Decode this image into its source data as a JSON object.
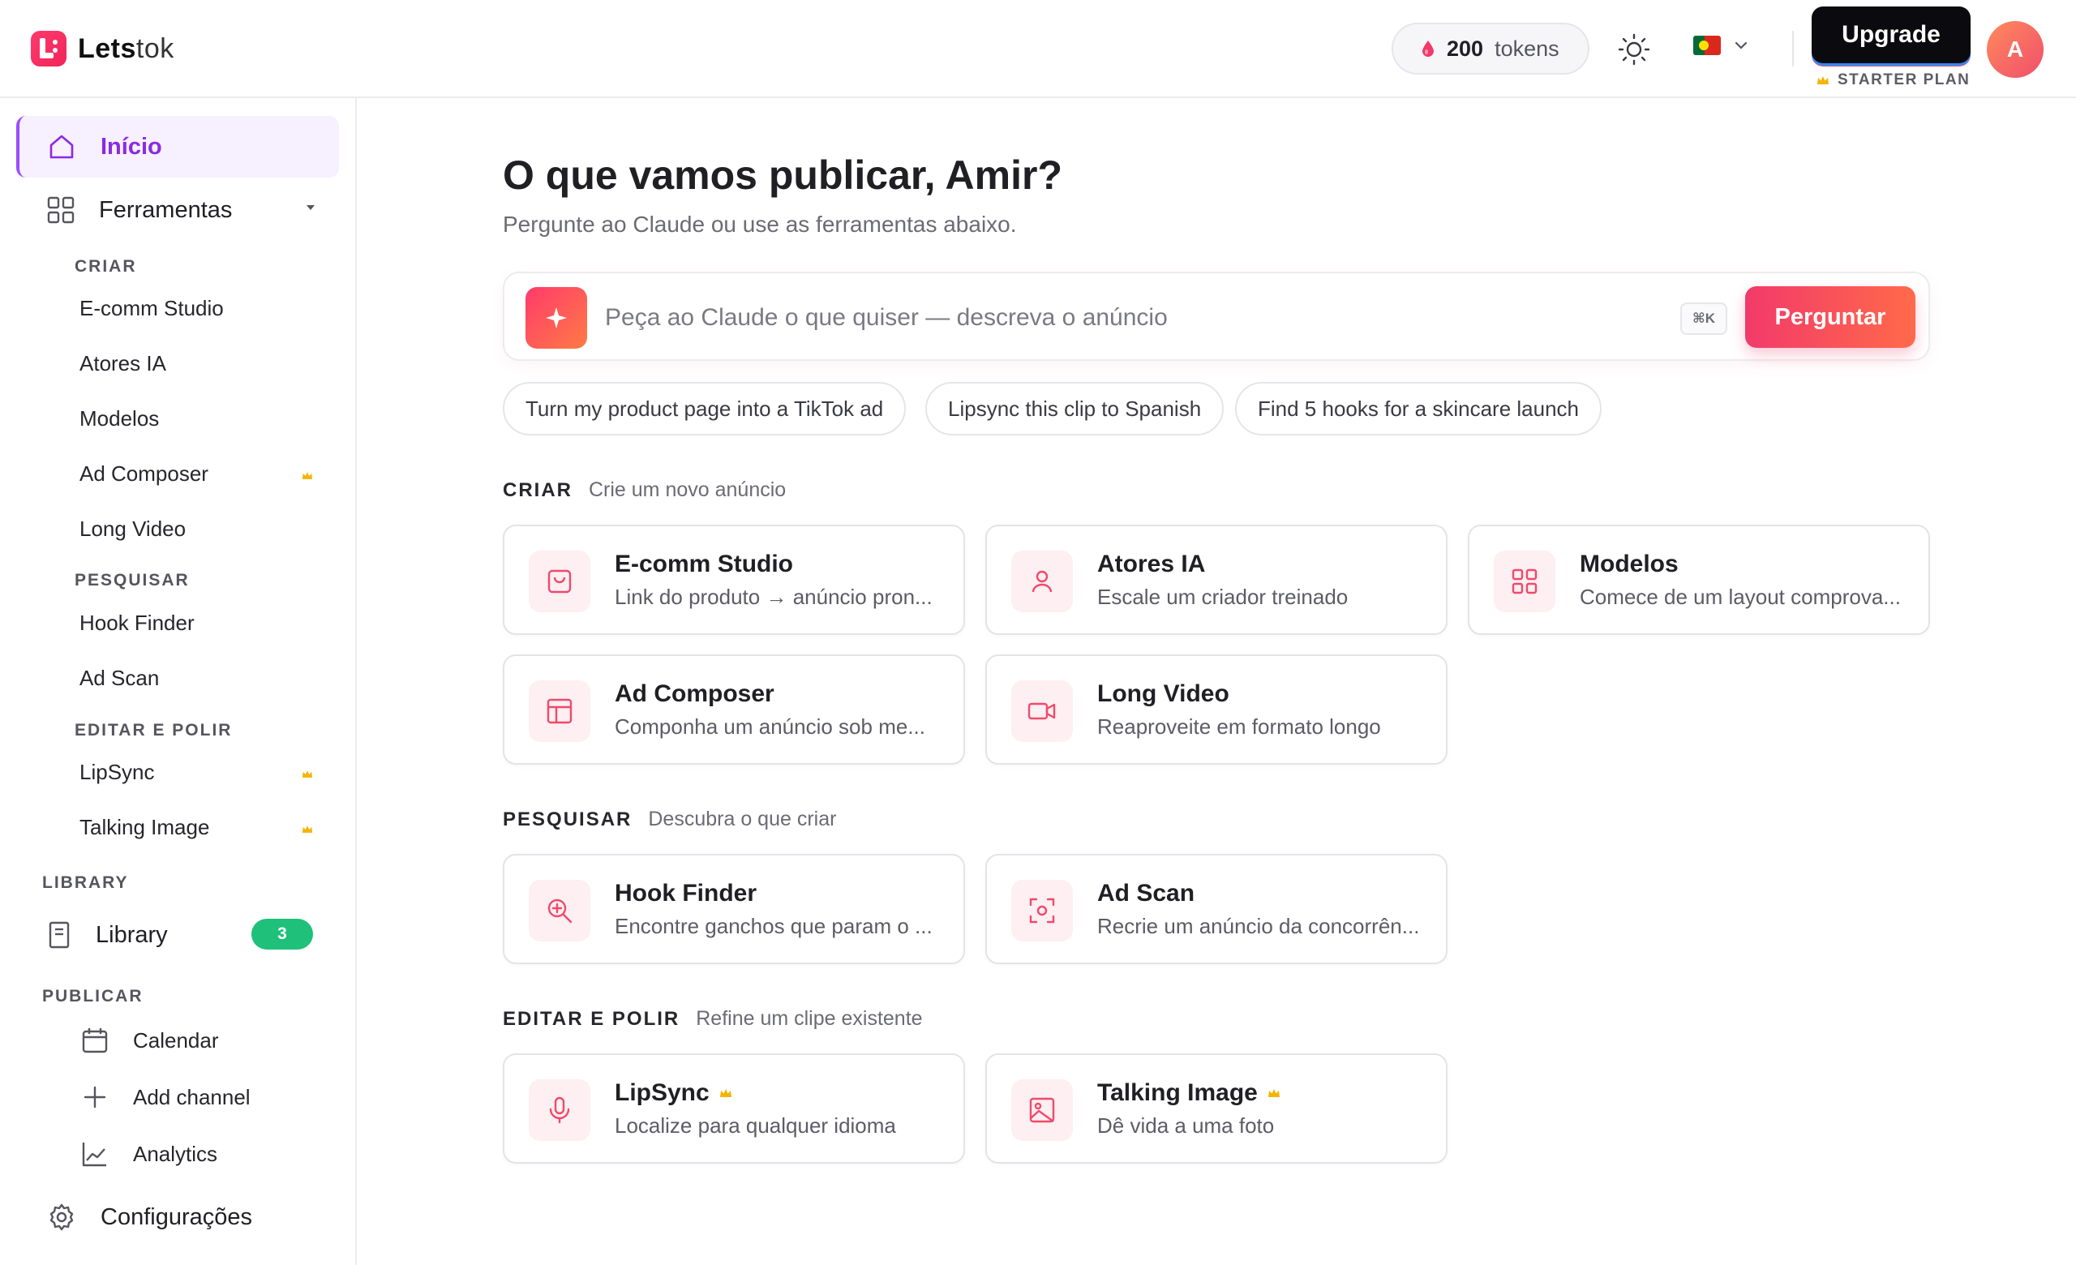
{
  "brand": {
    "name_bold": "Lets",
    "name_light": "tok"
  },
  "header": {
    "tokens_count": "200",
    "tokens_label": "tokens",
    "upgrade_label": "Upgrade",
    "plan_label": "STARTER PLAN",
    "avatar_initial": "A",
    "language": "Portuguese"
  },
  "sidebar": {
    "home": "Início",
    "tools": "Ferramentas",
    "sections": {
      "criar": "CRIAR",
      "pesquisar": "PESQUISAR",
      "editar": "EDITAR E POLIR",
      "library": "LIBRARY",
      "publicar": "PUBLICAR"
    },
    "criar_items": [
      "E-comm Studio",
      "Atores IA",
      "Modelos",
      "Ad Composer",
      "Long Video"
    ],
    "pesquisar_items": [
      "Hook Finder",
      "Ad Scan"
    ],
    "editar_items": [
      "LipSync",
      "Talking Image"
    ],
    "library_label": "Library",
    "library_count": "3",
    "publicar_items": [
      "Calendar",
      "Add channel",
      "Analytics"
    ],
    "settings": "Configurações"
  },
  "main": {
    "title": "O que vamos publicar, Amir?",
    "subtitle": "Pergunte ao Claude ou use as ferramentas abaixo.",
    "ask": {
      "placeholder": "Peça ao Claude o que quiser — descreva o anúncio",
      "shortcut": "⌘K",
      "button": "Perguntar"
    },
    "suggestions": [
      "Turn my product page into a TikTok ad",
      "Lipsync this clip to Spanish",
      "Find 5 hooks for a skincare launch"
    ],
    "sections": [
      {
        "title": "CRIAR",
        "desc": "Crie um novo anúncio",
        "cards": [
          {
            "title": "E-comm Studio",
            "desc": "Link do produto → anúncio pron...",
            "icon": "bag-icon"
          },
          {
            "title": "Atores IA",
            "desc": "Escale um criador treinado",
            "icon": "user-icon"
          },
          {
            "title": "Modelos",
            "desc": "Comece de um layout comprova...",
            "icon": "grid-icon"
          },
          {
            "title": "Ad Composer",
            "desc": "Componha um anúncio sob me...",
            "icon": "layout-icon"
          },
          {
            "title": "Long Video",
            "desc": "Reaproveite em formato longo",
            "icon": "video-icon"
          }
        ]
      },
      {
        "title": "PESQUISAR",
        "desc": "Descubra o que criar",
        "cards": [
          {
            "title": "Hook Finder",
            "desc": "Encontre ganchos que param o ...",
            "icon": "zoom-icon"
          },
          {
            "title": "Ad Scan",
            "desc": "Recrie um anúncio da concorrên...",
            "icon": "scan-icon"
          }
        ]
      },
      {
        "title": "EDITAR E POLIR",
        "desc": "Refine um clipe existente",
        "cards": [
          {
            "title": "LipSync",
            "desc": "Localize para qualquer idioma",
            "icon": "mic-icon",
            "premium": true
          },
          {
            "title": "Talking Image",
            "desc": "Dê vida a uma foto",
            "icon": "image-icon",
            "premium": true
          }
        ]
      }
    ]
  },
  "colors": {
    "accent": "#f23a6a",
    "active_nav": "#8a2be2",
    "crown": "#f5b400",
    "badge_green": "#1ec07a"
  }
}
